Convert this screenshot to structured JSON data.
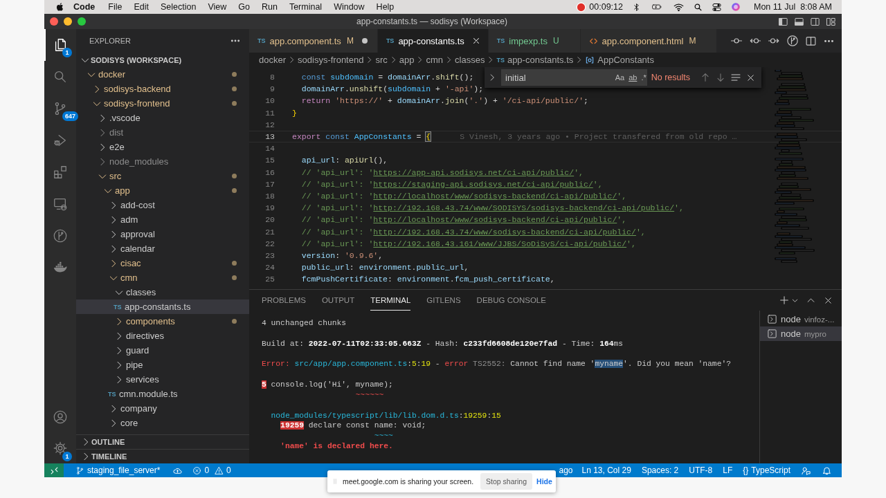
{
  "menubar": {
    "app": "Code",
    "menus": [
      "File",
      "Edit",
      "Selection",
      "View",
      "Go",
      "Run",
      "Terminal",
      "Window",
      "Help"
    ],
    "recording_time": "00:09:12",
    "clock": "Mon 11 Jul  8:08 AM"
  },
  "window": {
    "title": "app-constants.ts — sodisys (Workspace)"
  },
  "activity_bar": {
    "items": [
      {
        "kind": "explorer",
        "selected": true,
        "badge": "1"
      },
      {
        "kind": "search",
        "selected": false
      },
      {
        "kind": "source-control",
        "selected": false,
        "badge": "647"
      },
      {
        "kind": "run",
        "selected": false
      },
      {
        "kind": "extensions",
        "selected": false
      },
      {
        "kind": "remote",
        "selected": false
      },
      {
        "kind": "gitlens",
        "selected": false
      },
      {
        "kind": "docker",
        "selected": false
      }
    ],
    "bottom": [
      {
        "kind": "account"
      },
      {
        "kind": "settings",
        "badge": "1"
      }
    ]
  },
  "explorer": {
    "title": "EXPLORER",
    "workspace": {
      "label": "SODISYS (WORKSPACE)",
      "expanded": true
    },
    "tree": [
      {
        "label": "docker",
        "kind": "folder",
        "expanded": true,
        "modified": true,
        "ignored": false,
        "selected": false,
        "children": [
          {
            "label": "sodisys-backend",
            "kind": "folder",
            "expanded": false,
            "modified": true,
            "ignored": false,
            "selected": false
          },
          {
            "label": "sodisys-frontend",
            "kind": "folder",
            "expanded": true,
            "modified": true,
            "ignored": false,
            "selected": false,
            "children": [
              {
                "label": ".vscode",
                "kind": "folder",
                "expanded": false,
                "modified": false,
                "ignored": false,
                "selected": false
              },
              {
                "label": "dist",
                "kind": "folder",
                "expanded": false,
                "modified": false,
                "ignored": true,
                "selected": false
              },
              {
                "label": "e2e",
                "kind": "folder",
                "expanded": false,
                "modified": false,
                "ignored": false,
                "selected": false
              },
              {
                "label": "node_modules",
                "kind": "folder",
                "expanded": false,
                "modified": false,
                "ignored": true,
                "selected": false
              },
              {
                "label": "src",
                "kind": "folder",
                "expanded": true,
                "modified": true,
                "ignored": false,
                "selected": false,
                "children": [
                  {
                    "label": "app",
                    "kind": "folder",
                    "expanded": true,
                    "modified": true,
                    "ignored": false,
                    "selected": false,
                    "children": [
                      {
                        "label": "add-cost",
                        "kind": "folder",
                        "expanded": false,
                        "modified": false,
                        "ignored": false,
                        "selected": false
                      },
                      {
                        "label": "adm",
                        "kind": "folder",
                        "expanded": false,
                        "modified": false,
                        "ignored": false,
                        "selected": false
                      },
                      {
                        "label": "approval",
                        "kind": "folder",
                        "expanded": false,
                        "modified": false,
                        "ignored": false,
                        "selected": false
                      },
                      {
                        "label": "calendar",
                        "kind": "folder",
                        "expanded": false,
                        "modified": false,
                        "ignored": false,
                        "selected": false
                      },
                      {
                        "label": "cisac",
                        "kind": "folder",
                        "expanded": false,
                        "modified": true,
                        "ignored": false,
                        "selected": false
                      },
                      {
                        "label": "cmn",
                        "kind": "folder",
                        "expanded": true,
                        "modified": true,
                        "ignored": false,
                        "selected": false,
                        "children": [
                          {
                            "label": "classes",
                            "kind": "folder",
                            "expanded": true,
                            "modified": false,
                            "ignored": false,
                            "selected": false,
                            "children": [
                              {
                                "label": "app-constants.ts",
                                "kind": "file",
                                "icon_text": "TS",
                                "modified": false,
                                "ignored": false,
                                "selected": true
                              }
                            ]
                          },
                          {
                            "label": "components",
                            "kind": "folder",
                            "expanded": false,
                            "modified": true,
                            "ignored": false,
                            "selected": false
                          },
                          {
                            "label": "directives",
                            "kind": "folder",
                            "expanded": false,
                            "modified": false,
                            "ignored": false,
                            "selected": false
                          },
                          {
                            "label": "guard",
                            "kind": "folder",
                            "expanded": false,
                            "modified": false,
                            "ignored": false,
                            "selected": false
                          },
                          {
                            "label": "pipe",
                            "kind": "folder",
                            "expanded": false,
                            "modified": false,
                            "ignored": false,
                            "selected": false
                          },
                          {
                            "label": "services",
                            "kind": "folder",
                            "expanded": false,
                            "modified": false,
                            "ignored": false,
                            "selected": false
                          },
                          {
                            "label": "cmn.module.ts",
                            "kind": "file",
                            "icon_text": "TS",
                            "modified": false,
                            "ignored": false,
                            "selected": false
                          }
                        ]
                      },
                      {
                        "label": "company",
                        "kind": "folder",
                        "expanded": false,
                        "modified": false,
                        "ignored": false,
                        "selected": false
                      },
                      {
                        "label": "core",
                        "kind": "folder",
                        "expanded": false,
                        "modified": false,
                        "ignored": false,
                        "selected": false
                      }
                    ]
                  }
                ]
              }
            ]
          }
        ]
      }
    ],
    "sections": [
      {
        "label": "OUTLINE",
        "expanded": false
      },
      {
        "label": "TIMELINE",
        "expanded": false
      }
    ]
  },
  "tabs": [
    {
      "label": "app.component.ts",
      "kind": "ts",
      "icon_text": "TS",
      "status": "M",
      "dirty": true,
      "selected": false,
      "color": "#e2c08d"
    },
    {
      "label": "app-constants.ts",
      "kind": "ts",
      "icon_text": "TS",
      "dirty": false,
      "selected": true,
      "color": "#ffffff"
    },
    {
      "label": "impexp.ts",
      "kind": "ts",
      "icon_text": "TS",
      "status": "U",
      "dirty": false,
      "selected": false,
      "color": "#73c991"
    },
    {
      "label": "app.component.html",
      "kind": "html",
      "status": "M",
      "dirty": false,
      "selected": false,
      "color": "#e2c08d"
    }
  ],
  "breadcrumb": [
    {
      "label": "docker",
      "kind": "folder"
    },
    {
      "label": "sodisys-frontend",
      "kind": "folder"
    },
    {
      "label": "src",
      "kind": "folder"
    },
    {
      "label": "app",
      "kind": "folder"
    },
    {
      "label": "cmn",
      "kind": "folder"
    },
    {
      "label": "classes",
      "kind": "folder"
    },
    {
      "label": "app-constants.ts",
      "kind": "file",
      "icon_text": "TS"
    },
    {
      "label": "AppConstants",
      "kind": "symbol"
    }
  ],
  "find": {
    "value": "initial",
    "options": [
      "Aa",
      "ab",
      ".*"
    ],
    "result": "No results"
  },
  "editor": {
    "lines": [
      {
        "number": "8",
        "current": false,
        "tokens": [
          {
            "kind": "kw",
            "text": "  const "
          },
          {
            "kind": "const",
            "text": "subdomain"
          },
          {
            "kind": "plain",
            "text": " = "
          },
          {
            "kind": "var",
            "text": "domainArr"
          },
          {
            "kind": "plain",
            "text": "."
          },
          {
            "kind": "fn",
            "text": "shift"
          },
          {
            "kind": "plain",
            "text": "();"
          }
        ]
      },
      {
        "number": "9",
        "current": false,
        "tokens": [
          {
            "kind": "var",
            "text": "  domainArr"
          },
          {
            "kind": "plain",
            "text": "."
          },
          {
            "kind": "fn",
            "text": "unshift"
          },
          {
            "kind": "plain",
            "text": "("
          },
          {
            "kind": "const",
            "text": "subdomain"
          },
          {
            "kind": "plain",
            "text": " + "
          },
          {
            "kind": "str",
            "text": "'-api'"
          },
          {
            "kind": "plain",
            "text": ");"
          }
        ]
      },
      {
        "number": "10",
        "current": false,
        "tokens": [
          {
            "kind": "ctl",
            "text": "  return "
          },
          {
            "kind": "str",
            "text": "'https://'"
          },
          {
            "kind": "plain",
            "text": " + "
          },
          {
            "kind": "var",
            "text": "domainArr"
          },
          {
            "kind": "plain",
            "text": "."
          },
          {
            "kind": "fn",
            "text": "join"
          },
          {
            "kind": "plain",
            "text": "("
          },
          {
            "kind": "str",
            "text": "'.'"
          },
          {
            "kind": "plain",
            "text": ") + "
          },
          {
            "kind": "str",
            "text": "'/ci-api/public/'"
          },
          {
            "kind": "plain",
            "text": ";"
          }
        ]
      },
      {
        "number": "11",
        "current": false,
        "tokens": [
          {
            "kind": "brace",
            "text": "}"
          }
        ]
      },
      {
        "number": "12",
        "current": false
      },
      {
        "number": "13",
        "current": true,
        "tokens": [
          {
            "kind": "ctl",
            "text": "export "
          },
          {
            "kind": "kw",
            "text": "const "
          },
          {
            "kind": "const",
            "text": "AppConstants"
          },
          {
            "kind": "plain",
            "text": " = "
          },
          {
            "kind": "match",
            "text": "{"
          }
        ],
        "blame": "S Vinesh, 3 years ago • Project transfered from old repo …"
      },
      {
        "number": "14",
        "current": false
      },
      {
        "number": "15",
        "current": false,
        "tokens": [
          {
            "kind": "var",
            "text": "  api_url"
          },
          {
            "kind": "plain",
            "text": ": "
          },
          {
            "kind": "fn",
            "text": "apiUrl"
          },
          {
            "kind": "plain",
            "text": "(),"
          }
        ]
      },
      {
        "number": "16",
        "current": false,
        "tokens": [
          {
            "kind": "comment",
            "text": "  // 'api_url': '"
          },
          {
            "kind": "link",
            "text": "https://app-api.sodisys.net/ci-api/public/"
          },
          {
            "kind": "comment",
            "text": "',"
          }
        ]
      },
      {
        "number": "17",
        "current": false,
        "tokens": [
          {
            "kind": "comment",
            "text": "  // 'api_url': '"
          },
          {
            "kind": "link",
            "text": "https://staging-api.sodisys.net/ci-api/public/"
          },
          {
            "kind": "comment",
            "text": "',"
          }
        ]
      },
      {
        "number": "18",
        "current": false,
        "tokens": [
          {
            "kind": "comment",
            "text": "  // 'api_url': '"
          },
          {
            "kind": "link",
            "text": "http://localhost/www/sodisys-backend/ci-api/public/"
          },
          {
            "kind": "comment",
            "text": "',"
          }
        ]
      },
      {
        "number": "19",
        "current": false,
        "tokens": [
          {
            "kind": "comment",
            "text": "  // 'api_url': '"
          },
          {
            "kind": "link",
            "text": "http://192.168.43.74/www/SODISYS/sodisys-backend/ci-api/public/"
          },
          {
            "kind": "comment",
            "text": "',"
          }
        ]
      },
      {
        "number": "20",
        "current": false,
        "tokens": [
          {
            "kind": "comment",
            "text": "  // 'api_url': '"
          },
          {
            "kind": "link",
            "text": "http://localhost/www/sodisys-backend/ci-api/public/"
          },
          {
            "kind": "comment",
            "text": "',"
          }
        ]
      },
      {
        "number": "21",
        "current": false,
        "tokens": [
          {
            "kind": "comment",
            "text": "  // 'api_url': '"
          },
          {
            "kind": "link",
            "text": "http://192.168.43.74/www/sodisys-backend/ci-api/public/"
          },
          {
            "kind": "comment",
            "text": "',"
          }
        ]
      },
      {
        "number": "22",
        "current": false,
        "tokens": [
          {
            "kind": "comment",
            "text": "  // 'api_url': '"
          },
          {
            "kind": "link",
            "text": "http://192.168.43.161/www/JJBS/SoDiSyS/ci-api/public/"
          },
          {
            "kind": "comment",
            "text": "',"
          }
        ]
      },
      {
        "number": "23",
        "current": false,
        "tokens": [
          {
            "kind": "var",
            "text": "  version"
          },
          {
            "kind": "plain",
            "text": ": "
          },
          {
            "kind": "str",
            "text": "'0.9.6'"
          },
          {
            "kind": "plain",
            "text": ","
          }
        ]
      },
      {
        "number": "24",
        "current": false,
        "tokens": [
          {
            "kind": "var",
            "text": "  public_url"
          },
          {
            "kind": "plain",
            "text": ": "
          },
          {
            "kind": "var",
            "text": "environment"
          },
          {
            "kind": "plain",
            "text": "."
          },
          {
            "kind": "var",
            "text": "public_url"
          },
          {
            "kind": "plain",
            "text": ","
          }
        ]
      },
      {
        "number": "25",
        "current": false,
        "tokens": [
          {
            "kind": "var",
            "text": "  fcmPushCertificate"
          },
          {
            "kind": "plain",
            "text": ": "
          },
          {
            "kind": "var",
            "text": "environment"
          },
          {
            "kind": "plain",
            "text": "."
          },
          {
            "kind": "var",
            "text": "fcm_push_certificate"
          },
          {
            "kind": "plain",
            "text": ","
          }
        ]
      }
    ]
  },
  "panel": {
    "tabs": [
      {
        "label": "PROBLEMS",
        "selected": false
      },
      {
        "label": "OUTPUT",
        "selected": false
      },
      {
        "label": "TERMINAL",
        "selected": true
      },
      {
        "label": "GITLENS",
        "selected": false
      },
      {
        "label": "DEBUG CONSOLE",
        "selected": false
      }
    ],
    "terminal_lines": [
      {
        "kind": "text",
        "tokens": [
          {
            "kind": "plain",
            "text": "4 unchanged chunks"
          }
        ]
      },
      {
        "kind": "blank"
      },
      {
        "kind": "text",
        "tokens": [
          {
            "kind": "plain",
            "text": "Build at: "
          },
          {
            "kind": "bold",
            "text": "2022-07-11T02:33:05.663Z"
          },
          {
            "kind": "plain",
            "text": " - Hash: "
          },
          {
            "kind": "bold",
            "text": "c233fd6608de120e7fad"
          },
          {
            "kind": "plain",
            "text": " - Time: "
          },
          {
            "kind": "bold",
            "text": "164"
          },
          {
            "kind": "plain",
            "text": "ms"
          }
        ]
      },
      {
        "kind": "blank"
      },
      {
        "kind": "text",
        "tokens": [
          {
            "kind": "red",
            "text": "Error: "
          },
          {
            "kind": "cyan",
            "text": "src/app/app.component.ts"
          },
          {
            "kind": "plain",
            "text": ":"
          },
          {
            "kind": "yellow",
            "text": "5"
          },
          {
            "kind": "plain",
            "text": ":"
          },
          {
            "kind": "yellow",
            "text": "19"
          },
          {
            "kind": "plain",
            "text": " - "
          },
          {
            "kind": "red",
            "text": "error"
          },
          {
            "kind": "gray",
            "text": " TS2552:"
          },
          {
            "kind": "plain",
            "text": " Cannot find name '"
          },
          {
            "kind": "match",
            "text": "myname"
          },
          {
            "kind": "plain",
            "text": "'. Did you mean 'name'?"
          }
        ]
      },
      {
        "kind": "blank"
      },
      {
        "kind": "text",
        "tokens": [
          {
            "kind": "gutter",
            "text": "5"
          },
          {
            "kind": "plain",
            "text": " console.log('Hi', myname);"
          }
        ]
      },
      {
        "kind": "text",
        "tokens": [
          {
            "kind": "red",
            "text": "                    ~~~~~~"
          }
        ]
      },
      {
        "kind": "blank"
      },
      {
        "kind": "location",
        "tokens": [
          {
            "kind": "cyan",
            "text": "node_modules/typescript/lib/lib.dom.d.ts"
          },
          {
            "kind": "plain",
            "text": ":"
          },
          {
            "kind": "yellow",
            "text": "19259"
          },
          {
            "kind": "plain",
            "text": ":"
          },
          {
            "kind": "yellow",
            "text": "15"
          }
        ]
      },
      {
        "kind": "snippet",
        "tokens": [
          {
            "kind": "gutter",
            "text": "19259"
          },
          {
            "kind": "plain",
            "text": " declare const name: void;"
          }
        ]
      },
      {
        "kind": "text",
        "tokens": [
          {
            "kind": "cyan",
            "text": "                        ~~~~"
          }
        ]
      },
      {
        "kind": "snippet",
        "tokens": [
          {
            "kind": "redbold",
            "text": "'name' is declared here."
          }
        ]
      }
    ],
    "terminals": [
      {
        "name": "node",
        "detail": "vinfoz-...",
        "selected": false
      },
      {
        "name": "node",
        "detail": "mypro",
        "selected": true
      }
    ]
  },
  "status_bar": {
    "branch": "staging_file_server*",
    "errors": "0",
    "warnings": "0",
    "blame": "ago",
    "items": [
      "Ln 13, Col 29",
      "Spaces: 2",
      "UTF-8",
      "LF"
    ],
    "language_icon": "{}",
    "language": "TypeScript"
  },
  "share_bar": {
    "message": "meet.google.com is sharing your screen.",
    "stop": "Stop sharing",
    "hide": "Hide"
  }
}
